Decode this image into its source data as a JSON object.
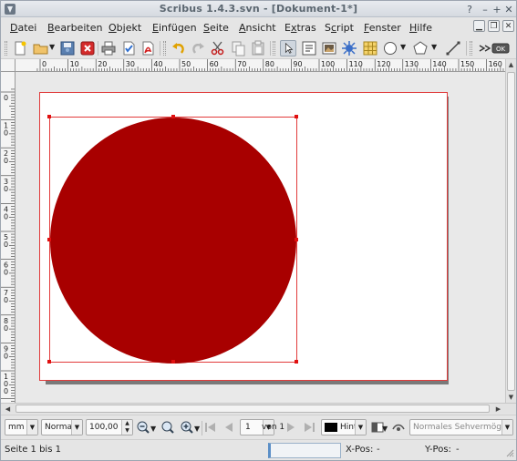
{
  "window": {
    "title": "Scribus 1.4.3.svn - [Dokument-1*]",
    "controls": [
      "?",
      "–",
      "+",
      "✕"
    ]
  },
  "menubar": {
    "items": [
      {
        "label": "Datei",
        "mnemonic": "D"
      },
      {
        "label": "Bearbeiten",
        "mnemonic": "B"
      },
      {
        "label": "Objekt",
        "mnemonic": "O"
      },
      {
        "label": "Einfügen",
        "mnemonic": "E"
      },
      {
        "label": "Seite",
        "mnemonic": "S"
      },
      {
        "label": "Ansicht",
        "mnemonic": "A"
      },
      {
        "label": "Extras",
        "mnemonic": "x"
      },
      {
        "label": "Script",
        "mnemonic": "c"
      },
      {
        "label": "Fenster",
        "mnemonic": "F"
      },
      {
        "label": "Hilfe",
        "mnemonic": "H"
      }
    ]
  },
  "rulers": {
    "horizontal_labels": [
      "0",
      "10",
      "20",
      "30",
      "40",
      "50",
      "60",
      "70",
      "80",
      "90",
      "100",
      "110",
      "120",
      "130",
      "140",
      "150",
      "160"
    ],
    "vertical_labels": [
      "0",
      "10",
      "20",
      "30",
      "40",
      "50",
      "60",
      "70",
      "80",
      "90",
      "100"
    ]
  },
  "bottombar": {
    "unit": "mm",
    "quality": "Normal",
    "zoom": "100,00 %",
    "page_number": "1",
    "page_of": "von 1",
    "layer": "Hint",
    "view_mode": "Normales Sehvermögen"
  },
  "statusbar": {
    "pages": "Seite 1 bis 1",
    "xpos_label": "X-Pos:",
    "xpos_value": "-",
    "ypos_label": "Y-Pos:",
    "ypos_value": "-"
  },
  "colors": {
    "circle_fill": "#a80000",
    "frame_outline": "#e03c3c",
    "page_shadow": "#7a7a7a"
  }
}
